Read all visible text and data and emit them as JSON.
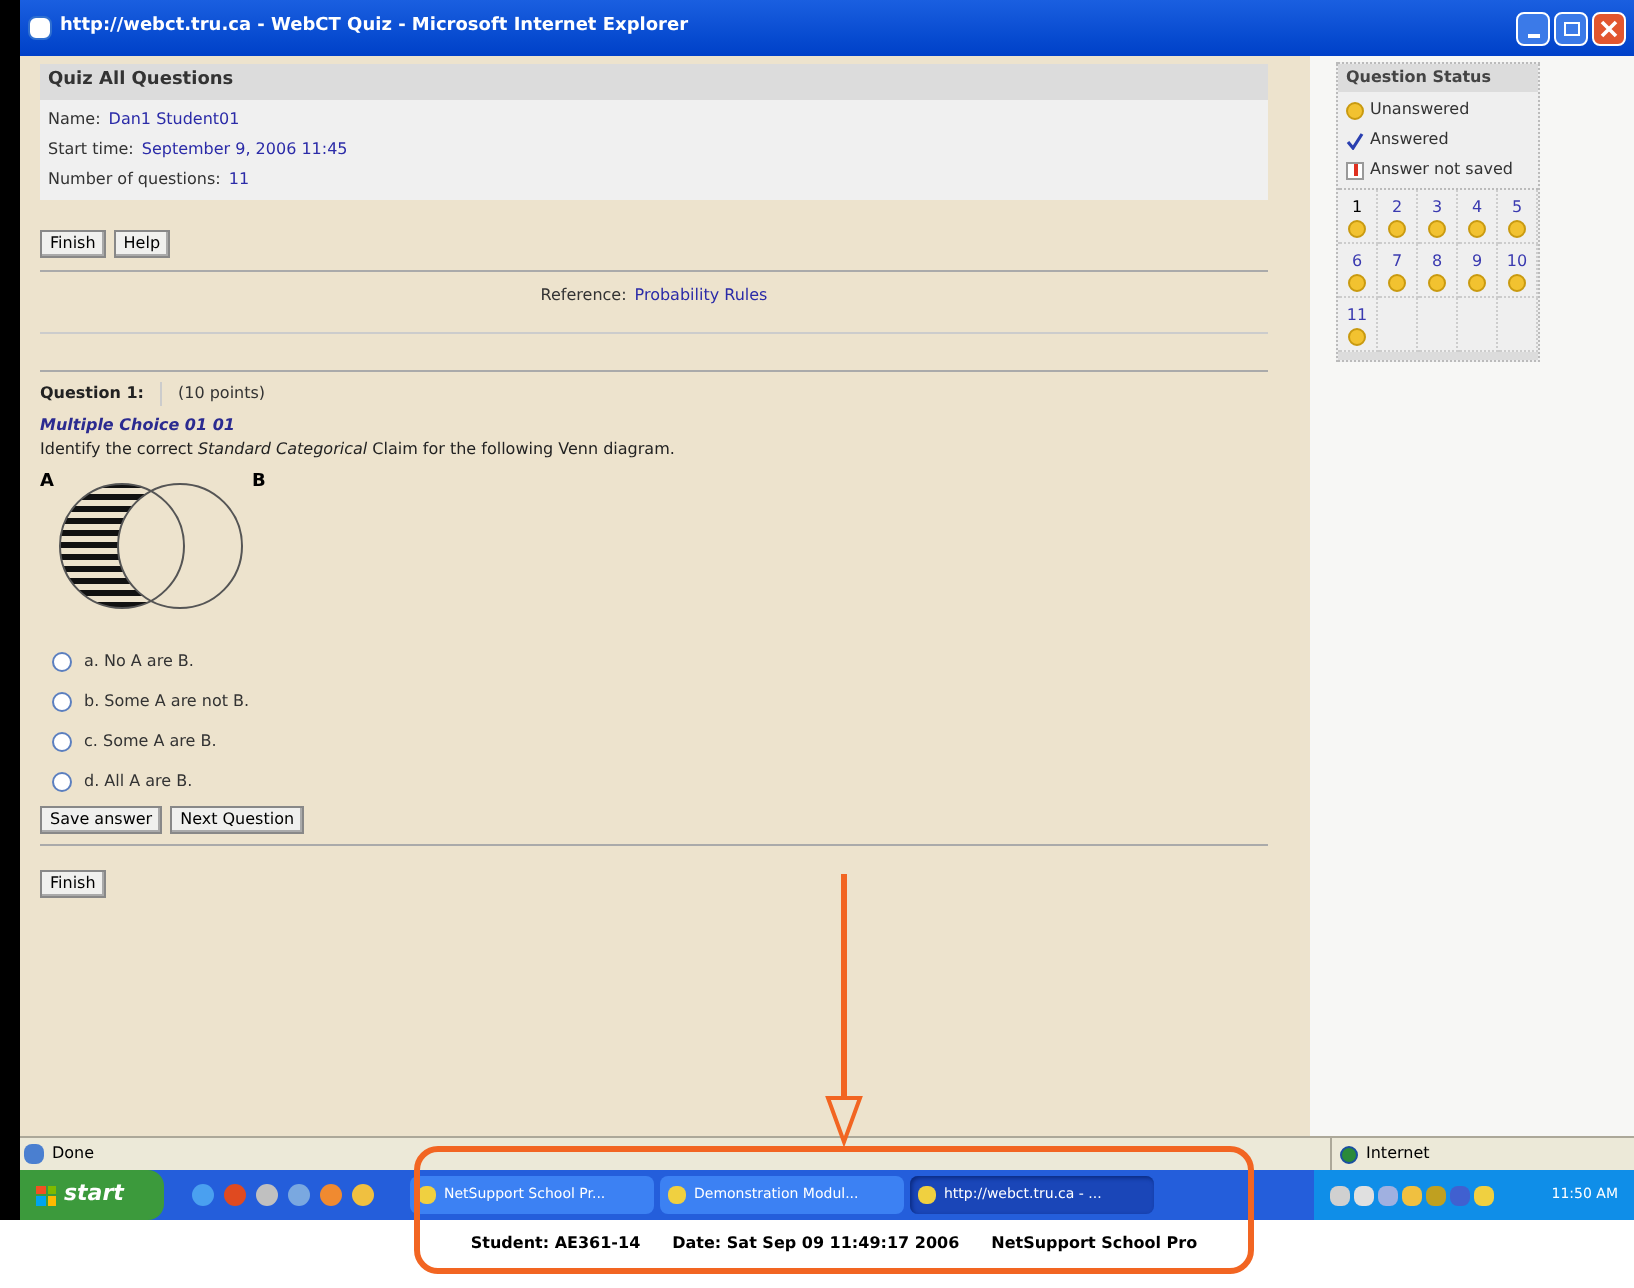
{
  "window": {
    "title": "http://webct.tru.ca - WebCT Quiz - Microsoft Internet Explorer"
  },
  "quiz": {
    "title": "Quiz All Questions",
    "info": [
      {
        "label": "Name:",
        "value": "Dan1 Student01"
      },
      {
        "label": "Start time:",
        "value": "September 9, 2006 11:45"
      },
      {
        "label": "Number of questions:",
        "value": "11"
      }
    ]
  },
  "top_buttons": [
    "Finish",
    "Help"
  ],
  "reference": {
    "label": "Reference:",
    "link": "Probability Rules"
  },
  "question": {
    "label": "Question 1:",
    "points": "(10 points)",
    "title": "Multiple Choice 01 01",
    "prompt": "Identify the correct *Standard Categorical* Claim for the following Venn diagram.",
    "venn": {
      "left_label": "A",
      "right_label": "B"
    },
    "options": [
      {
        "text": "a. No A are B.",
        "selected": false
      },
      {
        "text": "b. Some A are not B.",
        "selected": false
      },
      {
        "text": "c. Some A are B.",
        "selected": false
      },
      {
        "text": "d. All A are B.",
        "selected": false
      }
    ],
    "buttons": [
      "Save answer",
      "Next Question"
    ]
  },
  "bottom_buttons": [
    "Finish"
  ],
  "question_status": {
    "title": "Question Status",
    "legend": [
      {
        "kind": "unanswered",
        "label": "Unanswered"
      },
      {
        "kind": "answered",
        "label": "Answered"
      },
      {
        "kind": "not_saved",
        "label": "Answer not saved"
      }
    ],
    "questions": [
      {
        "number": "1",
        "selected": true,
        "kind": "unanswered"
      },
      {
        "number": "2",
        "selected": false,
        "kind": "unanswered"
      },
      {
        "number": "3",
        "selected": false,
        "kind": "unanswered"
      },
      {
        "number": "4",
        "selected": false,
        "kind": "unanswered"
      },
      {
        "number": "5",
        "selected": false,
        "kind": "unanswered"
      },
      {
        "number": "6",
        "selected": false,
        "kind": "unanswered"
      },
      {
        "number": "7",
        "selected": false,
        "kind": "unanswered"
      },
      {
        "number": "8",
        "selected": false,
        "kind": "unanswered"
      },
      {
        "number": "9",
        "selected": false,
        "kind": "unanswered"
      },
      {
        "number": "10",
        "selected": false,
        "kind": "unanswered"
      },
      {
        "number": "11",
        "selected": false,
        "kind": "unanswered"
      }
    ]
  },
  "status_bar": {
    "text": "Done",
    "zone": "Internet"
  },
  "taskbar": {
    "start": "start",
    "tasks": [
      {
        "label": "NetSupport School Pr...",
        "selected": false
      },
      {
        "label": "Demonstration Modul...",
        "selected": false
      },
      {
        "label": "http://webct.tru.ca - ...",
        "selected": true
      }
    ],
    "clock": "11:50 AM"
  },
  "caption": {
    "items": [
      "Student: AE361-14",
      "Date: Sat Sep 09 11:49:17 2006",
      "NetSupport School Pro"
    ]
  }
}
